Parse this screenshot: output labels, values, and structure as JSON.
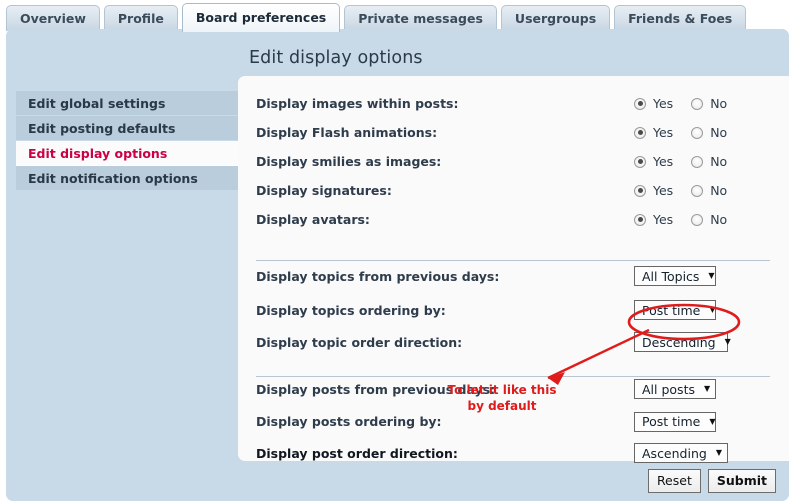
{
  "tabs": [
    {
      "label": "Overview",
      "active": false
    },
    {
      "label": "Profile",
      "active": false
    },
    {
      "label": "Board preferences",
      "active": true
    },
    {
      "label": "Private messages",
      "active": false
    },
    {
      "label": "Usergroups",
      "active": false
    },
    {
      "label": "Friends & Foes",
      "active": false
    }
  ],
  "page": {
    "title": "Edit display options"
  },
  "sidebar": {
    "items": [
      {
        "label": "Edit global settings",
        "active": false
      },
      {
        "label": "Edit posting defaults",
        "active": false
      },
      {
        "label": "Edit display options",
        "active": true
      },
      {
        "label": "Edit notification options",
        "active": false
      }
    ]
  },
  "radio_rows": [
    {
      "label": "Display images within posts:",
      "yes_label": "Yes",
      "no_label": "No",
      "selected": "yes"
    },
    {
      "label": "Display Flash animations:",
      "yes_label": "Yes",
      "no_label": "No",
      "selected": "yes"
    },
    {
      "label": "Display smilies as images:",
      "yes_label": "Yes",
      "no_label": "No",
      "selected": "yes"
    },
    {
      "label": "Display signatures:",
      "yes_label": "Yes",
      "no_label": "No",
      "selected": "yes"
    },
    {
      "label": "Display avatars:",
      "yes_label": "Yes",
      "no_label": "No",
      "selected": "yes"
    }
  ],
  "topic_rows": [
    {
      "label": "Display topics from previous days:",
      "value": "All Topics"
    },
    {
      "label": "Display topics ordering by:",
      "value": "Post time"
    },
    {
      "label": "Display topic order direction:",
      "value": "Descending"
    }
  ],
  "post_rows": [
    {
      "label": "Display posts from previous days:",
      "value": "All posts"
    },
    {
      "label": "Display posts ordering by:",
      "value": "Post time"
    },
    {
      "label": "Display post order direction:",
      "value": "Ascending"
    }
  ],
  "dropdown_arrow": "▼",
  "footer": {
    "reset_label": "Reset",
    "submit_label": "Submit"
  },
  "annotation": {
    "line1": "To let it like this",
    "line2": "by default",
    "color": "#e01b1b",
    "highlighted_field": "Descending"
  },
  "colors": {
    "panel_blue": "#c8d9e8",
    "sidebar_item": "#b9cddc",
    "active_link_red": "#cc0044",
    "card_bg": "#fafafa",
    "annotation_red": "#e01b1b"
  }
}
